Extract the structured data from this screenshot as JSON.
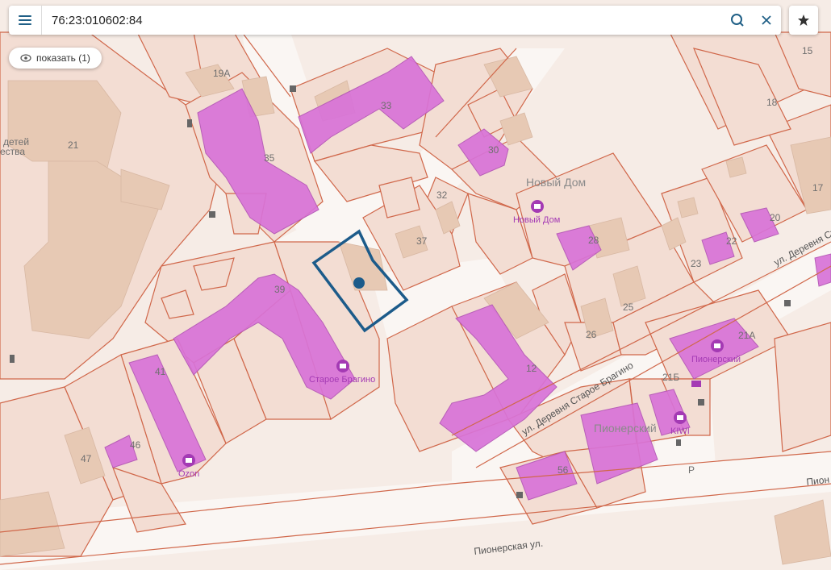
{
  "search": {
    "value": "76:23:010602:84"
  },
  "show_button": {
    "label": "показать (1)"
  },
  "icons": {
    "menu": "menu-icon",
    "search": "search-icon",
    "clear": "close-icon",
    "favorite": "star-icon",
    "show": "eye-icon"
  },
  "colors": {
    "parcel_border": "#d0674a",
    "parcel_fill": "#f3ddd3",
    "building": "#e7c9b4",
    "highlight_building": "#d873d8",
    "selected_parcel": "#1c5b8a",
    "poi": "#a43ab4",
    "background": "#f5e9e3"
  },
  "map": {
    "house_numbers": [
      "15",
      "19А",
      "18",
      "21",
      "33",
      "30",
      "35",
      "32",
      "17",
      "20",
      "22",
      "37",
      "28",
      "23",
      "39",
      "25",
      "26",
      "21А",
      "41",
      "12",
      "21Б",
      "46",
      "47",
      "56"
    ],
    "partial_labels": [
      "детей",
      "ества"
    ],
    "place_labels": {
      "novyi_dom_building": "Новый Дом",
      "pionersky_building": "Пионерский"
    },
    "pois": {
      "novyi_dom": "Новый Дом",
      "staroe_bragino": "Старое Брагино",
      "pionersky": "Пионерский",
      "kiwi": "KIWI",
      "ozon": "Ozon"
    },
    "streets": {
      "derevnya_staroe_bragino": "ул. Деревня Старое Брагино",
      "derevnya_st": "ул. Деревня Ст",
      "pionerskaya": "Пионерская ул.",
      "pion_partial": "Пион"
    },
    "parking": "P"
  }
}
